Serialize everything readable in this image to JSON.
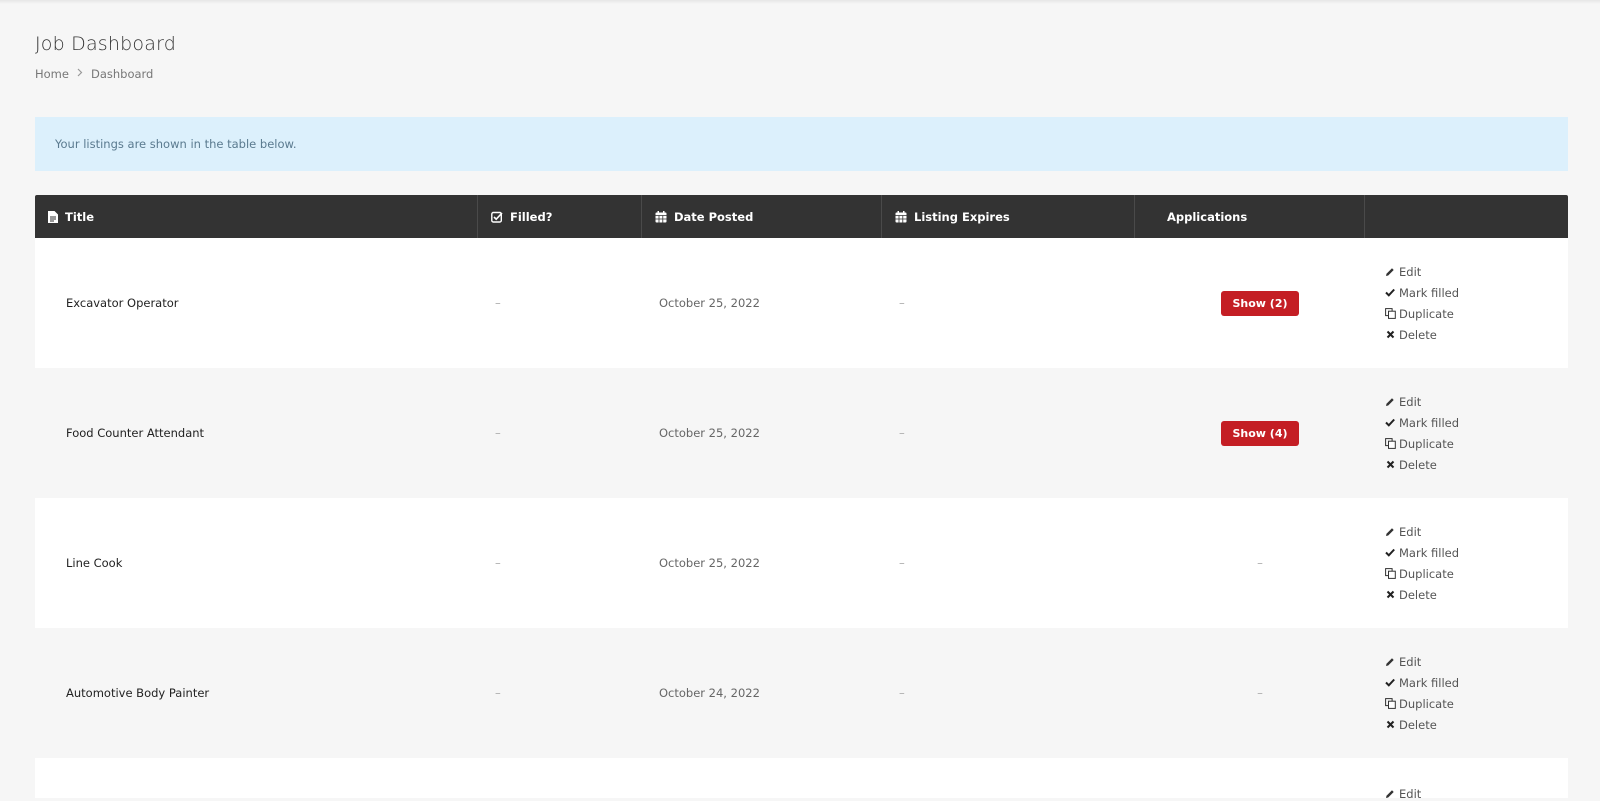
{
  "page": {
    "title": "Job Dashboard",
    "breadcrumb": {
      "home": "Home",
      "current": "Dashboard"
    }
  },
  "notice": "Your listings are shown in the table below.",
  "table": {
    "headers": {
      "title": "Title",
      "filled": "Filled?",
      "date_posted": "Date Posted",
      "listing_expires": "Listing Expires",
      "applications": "Applications",
      "actions": ""
    },
    "actions": {
      "edit": "Edit",
      "mark_filled": "Mark filled",
      "duplicate": "Duplicate",
      "delete": "Delete"
    },
    "rows": [
      {
        "title": "Excavator Operator",
        "filled": "–",
        "date_posted": "October 25, 2022",
        "expires": "–",
        "applications": "Show (2)"
      },
      {
        "title": "Food Counter Attendant",
        "filled": "–",
        "date_posted": "October 25, 2022",
        "expires": "–",
        "applications": "Show (4)"
      },
      {
        "title": "Line Cook",
        "filled": "–",
        "date_posted": "October 25, 2022",
        "expires": "–",
        "applications": "–"
      },
      {
        "title": "Automotive Body Painter",
        "filled": "–",
        "date_posted": "October 24, 2022",
        "expires": "–",
        "applications": "–"
      }
    ],
    "partial_row_action": "Edit"
  },
  "colors": {
    "header_bg": "#333333",
    "notice_bg": "#dcf0fc",
    "button_red": "#c41e24",
    "page_bg": "#f6f6f6"
  }
}
